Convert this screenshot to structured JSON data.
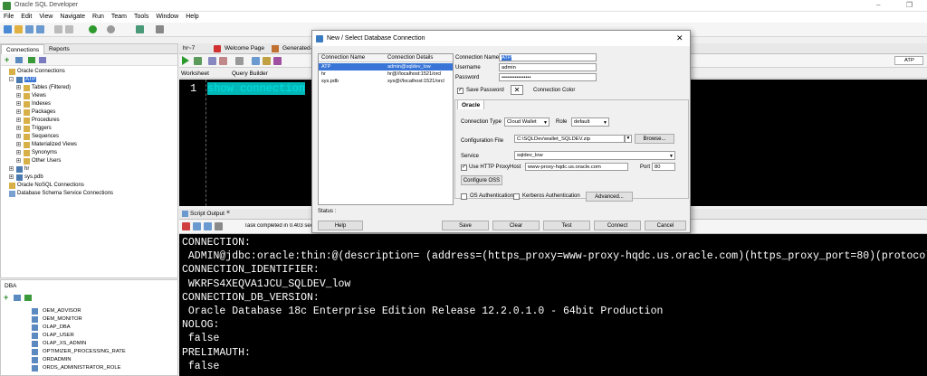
{
  "window": {
    "title": "Oracle SQL Developer",
    "restore_glyph": "–",
    "max_glyph": "❐"
  },
  "menu": [
    "File",
    "Edit",
    "View",
    "Navigate",
    "Run",
    "Team",
    "Tools",
    "Window",
    "Help"
  ],
  "left_panel": {
    "tabs": [
      "Connections",
      "Reports"
    ],
    "tree": [
      {
        "label": "Oracle Connections",
        "indent": 0,
        "icon": "folder"
      },
      {
        "label": "ATP",
        "indent": 1,
        "icon": "db",
        "selected": true
      },
      {
        "label": "Tables (Filtered)",
        "indent": 2,
        "icon": "folder"
      },
      {
        "label": "Views",
        "indent": 2,
        "icon": "folder"
      },
      {
        "label": "Indexes",
        "indent": 2,
        "icon": "folder"
      },
      {
        "label": "Packages",
        "indent": 2,
        "icon": "folder"
      },
      {
        "label": "Procedures",
        "indent": 2,
        "icon": "folder"
      },
      {
        "label": "Triggers",
        "indent": 2,
        "icon": "folder"
      },
      {
        "label": "Sequences",
        "indent": 2,
        "icon": "folder"
      },
      {
        "label": "Materialized Views",
        "indent": 2,
        "icon": "folder"
      },
      {
        "label": "Synonyms",
        "indent": 2,
        "icon": "folder"
      },
      {
        "label": "Other Users",
        "indent": 2,
        "icon": "folder"
      },
      {
        "label": "hr",
        "indent": 1,
        "icon": "db"
      },
      {
        "label": "sys.pdb",
        "indent": 1,
        "icon": "db"
      },
      {
        "label": "Oracle NoSQL Connections",
        "indent": 0,
        "icon": "folder"
      },
      {
        "label": "Database Schema Service Connections",
        "indent": 0,
        "icon": "cloud"
      }
    ]
  },
  "dba_panel": {
    "title": "DBA",
    "items": [
      "OEM_ADVISOR",
      "OEM_MONITOR",
      "OLAP_DBA",
      "OLAP_USER",
      "OLAP_XS_ADMIN",
      "OPTIMIZER_PROCESSING_RATE",
      "ORDADMIN",
      "ORDS_ADMINISTRATOR_ROLE"
    ]
  },
  "doc_tabs": [
    "hr~7",
    "Welcome Page",
    "Generated-2"
  ],
  "right_conn": "ATP",
  "worksheet": {
    "tabs": [
      "Worksheet",
      "Query Builder"
    ],
    "line": "1",
    "code": "show connection"
  },
  "output": {
    "tab": "Script Output",
    "status": "Task completed in 0.403 seconds",
    "lines": [
      "CONNECTION:",
      " ADMIN@jdbc:oracle:thin:@(description= (address=(https_proxy=www-proxy-hqdc.us.oracle.com)(https_proxy_port=80)(protocol=tcps)(",
      "CONNECTION_IDENTIFIER:",
      " WKRFS4XEQVA1JCU_SQLDEV_low",
      "CONNECTION_DB_VERSION:",
      " Oracle Database 18c Enterprise Edition Release 12.2.0.1.0 - 64bit Production",
      "NOLOG:",
      " false",
      "PRELIMAUTH:",
      " false"
    ]
  },
  "dialog": {
    "title": "New / Select Database Connection",
    "close": "✕",
    "col_name": "Connection Name",
    "col_details": "Connection Details",
    "connections": [
      {
        "name": "ATP",
        "details": "admin@sqldev_low",
        "selected": true
      },
      {
        "name": "hr",
        "details": "hr@//localhost:1521/orcl"
      },
      {
        "name": "sys.pdb",
        "details": "sys@//localhost:1521/orcl"
      }
    ],
    "conn_name_label": "Connection Name",
    "conn_name": "ATP",
    "user_label": "Username",
    "user": "admin",
    "pwd_label": "Password",
    "pwd": "••••••••••••••••",
    "save_pwd": "Save Password",
    "conn_color": "Connection Color",
    "oracle_tab": "Oracle",
    "conn_type_label": "Connection Type",
    "conn_type": "Cloud Wallet",
    "role_label": "Role",
    "role": "default",
    "config_label": "Configuration File",
    "config": "C:\\SQLDev\\wallet_SQLDEV.zip",
    "browse": "Browse...",
    "service_label": "Service",
    "service": "sqldev_low",
    "proxy_label": "Use HTTP Proxy",
    "host_label": "Host",
    "host": "www-proxy-hqdc.us.oracle.com",
    "port_label": "Port",
    "port": "80",
    "configure_oss": "Configure OSS",
    "os_auth": "OS Authentication",
    "kerberos": "Kerberos Authentication",
    "advanced": "Advanced...",
    "status": "Status :",
    "buttons": {
      "help": "Help",
      "save": "Save",
      "clear": "Clear",
      "test": "Test",
      "connect": "Connect",
      "cancel": "Cancel"
    }
  }
}
